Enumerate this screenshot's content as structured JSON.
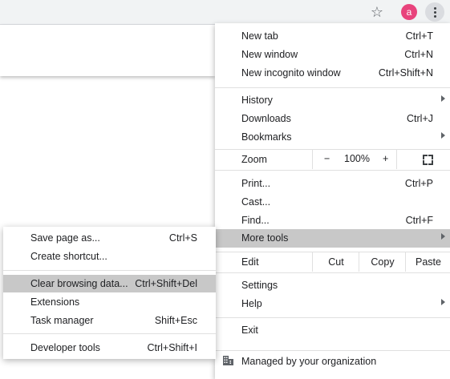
{
  "toolbar": {
    "star_icon": "star-outline-icon",
    "avatar_letter": "a",
    "avatar_color": "#e8437c",
    "menu_icon": "three-dot-vertical-icon"
  },
  "menu": {
    "new_tab": {
      "label": "New tab",
      "shortcut": "Ctrl+T"
    },
    "new_window": {
      "label": "New window",
      "shortcut": "Ctrl+N"
    },
    "new_incognito": {
      "label": "New incognito window",
      "shortcut": "Ctrl+Shift+N"
    },
    "history": {
      "label": "History"
    },
    "downloads": {
      "label": "Downloads",
      "shortcut": "Ctrl+J"
    },
    "bookmarks": {
      "label": "Bookmarks"
    },
    "zoom": {
      "label": "Zoom",
      "minus": "−",
      "level": "100%",
      "plus": "+"
    },
    "print": {
      "label": "Print...",
      "shortcut": "Ctrl+P"
    },
    "cast": {
      "label": "Cast..."
    },
    "find": {
      "label": "Find...",
      "shortcut": "Ctrl+F"
    },
    "more_tools": {
      "label": "More tools"
    },
    "edit": {
      "label": "Edit",
      "cut": "Cut",
      "copy": "Copy",
      "paste": "Paste"
    },
    "settings": {
      "label": "Settings"
    },
    "help": {
      "label": "Help"
    },
    "exit": {
      "label": "Exit"
    },
    "managed": {
      "label": "Managed by your organization"
    }
  },
  "submenu": {
    "save_page": {
      "label": "Save page as...",
      "shortcut": "Ctrl+S"
    },
    "create_shortcut": {
      "label": "Create shortcut..."
    },
    "clear_browsing": {
      "label": "Clear browsing data...",
      "shortcut": "Ctrl+Shift+Del"
    },
    "extensions": {
      "label": "Extensions"
    },
    "task_manager": {
      "label": "Task manager",
      "shortcut": "Shift+Esc"
    },
    "developer_tools": {
      "label": "Developer tools",
      "shortcut": "Ctrl+Shift+I"
    }
  }
}
